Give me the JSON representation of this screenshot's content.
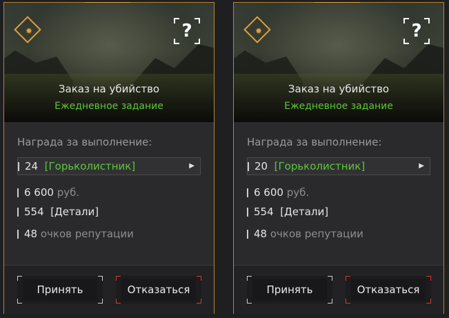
{
  "cards": [
    {
      "title": "Заказ на убийство",
      "subtitle": "Ежедневное задание",
      "reward_heading": "Награда за выполнение:",
      "item_count": "24",
      "item_name": "[Горьколистник]",
      "money_value": "6 600",
      "money_unit": "руб.",
      "parts_value": "554",
      "parts_name": "[Детали]",
      "rep_value": "48",
      "rep_unit": "очков репутации",
      "help_label": "?",
      "accept_label": "Принять",
      "decline_label": "Отказаться"
    },
    {
      "title": "Заказ на убийство",
      "subtitle": "Ежедневное задание",
      "reward_heading": "Награда за выполнение:",
      "item_count": "20",
      "item_name": "[Горьколистник]",
      "money_value": "6 600",
      "money_unit": "руб.",
      "parts_value": "554",
      "parts_name": "[Детали]",
      "rep_value": "48",
      "rep_unit": "очков репутации",
      "help_label": "?",
      "accept_label": "Принять",
      "decline_label": "Отказаться"
    }
  ],
  "icons": {
    "mission_badge": "sun-diamond-icon",
    "item_expand": "triangle-right-icon"
  },
  "colors": {
    "accent": "#e0a03a",
    "reward_green": "#5ec63a",
    "decline_red": "#d23a3a"
  }
}
